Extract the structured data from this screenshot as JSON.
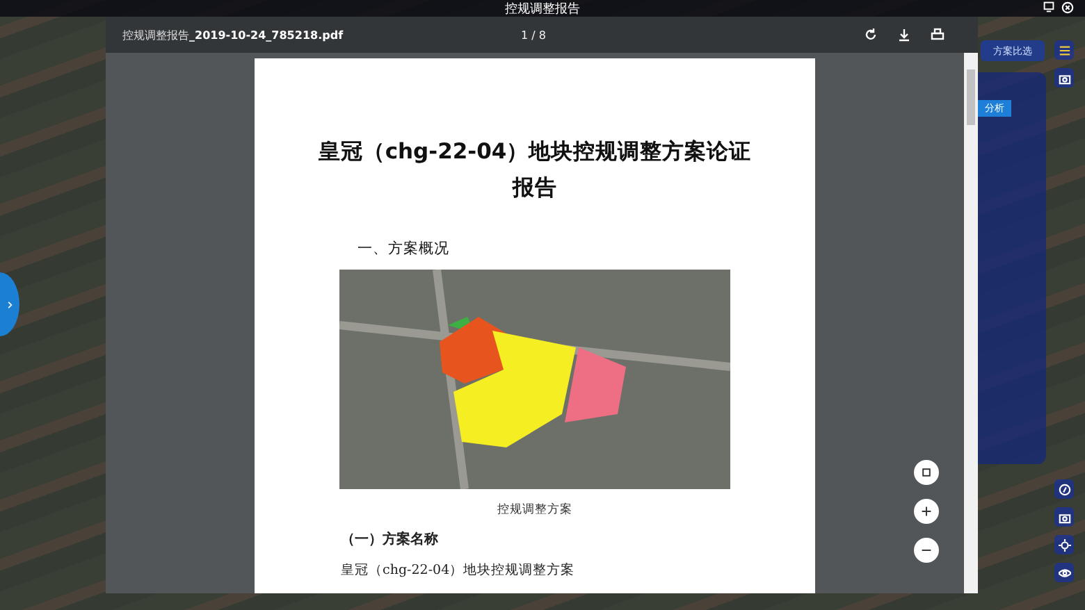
{
  "app": {
    "modal_title": "控规调整报告",
    "compare_button": "方案比选",
    "analysis_button": "分析"
  },
  "viewer": {
    "file_name": "控规调整报告**_2019-10-24_785218.pdf**",
    "page_indicator": "1 / 8",
    "document": {
      "title": "皇冠（chg-22-04）地块控规调整方案论证报告",
      "section_heading": "一、方案概况",
      "figure_caption": "控规调整方案",
      "subsection_heading": "（一）方案名称",
      "body_text": "皇冠（chg-22-04）地块控规调整方案"
    }
  }
}
